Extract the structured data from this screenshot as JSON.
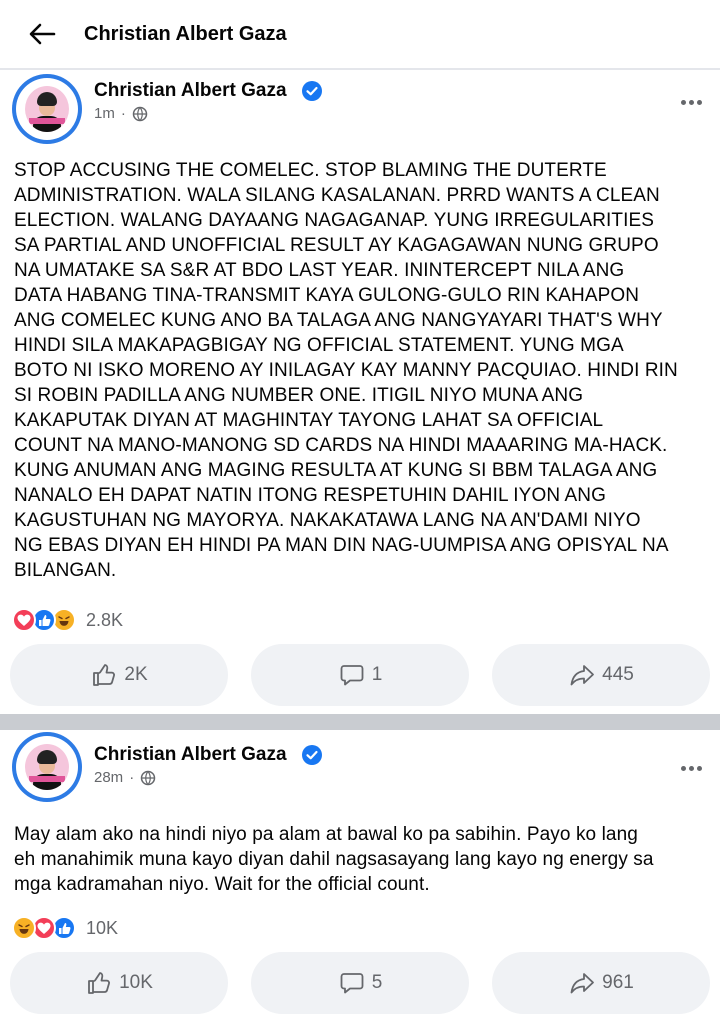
{
  "header": {
    "title": "Christian Albert Gaza",
    "back_icon": "arrow-left-icon"
  },
  "colors": {
    "verified": "#1877f2",
    "love": "#f33e58",
    "like": "#1877f2",
    "haha": "#f7b125",
    "muted_text": "#65676b",
    "button_bg": "#f0f2f5",
    "divider": "#c9ccd1"
  },
  "posts": [
    {
      "author": "Christian Albert Gaza",
      "time": "1m",
      "separator": "·",
      "audience_icon": "globe-icon",
      "verified_icon": "verified-badge-icon",
      "lines": [
        "STOP ACCUSING THE COMELEC. STOP BLAMING THE DUTERTE",
        "ADMINISTRATION. WALA SILANG KASALANAN. PRRD WANTS A CLEAN",
        "ELECTION. WALANG DAYAANG NAGAGANAP. YUNG IRREGULARITIES",
        "SA PARTIAL AND UNOFFICIAL RESULT AY KAGAGAWAN NUNG GRUPO",
        "NA UMATAKE SA S&R AT BDO LAST YEAR. ININTERCEPT NILA ANG",
        "DATA HABANG TINA-TRANSMIT KAYA GULONG-GULO RIN KAHAPON",
        "ANG COMELEC KUNG ANO BA TALAGA ANG NANGYAYARI THAT'S WHY",
        "HINDI SILA MAKAPAGBIGAY NG OFFICIAL STATEMENT. YUNG MGA",
        "BOTO NI ISKO MORENO AY INILAGAY KAY MANNY PACQUIAO. HINDI RIN",
        "SI ROBIN PADILLA ANG NUMBER ONE. ITIGIL NIYO MUNA ANG",
        "KAKAPUTAK DIYAN AT MAGHINTAY TAYONG LAHAT SA OFFICIAL",
        "COUNT NA MANO-MANONG SD CARDS NA HINDI MAAARING MA-HACK.",
        "KUNG ANUMAN ANG MAGING RESULTA AT KUNG SI BBM TALAGA ANG",
        "NANALO EH DAPAT NATIN ITONG RESPETUHIN DAHIL IYON ANG",
        "KAGUSTUHAN NG MAYORYA. NAKAKATAWA LANG NA AN'DAMI NIYO",
        "NG EBAS DIYAN EH HINDI PA MAN DIN NAG-UUMPISA ANG OPISYAL NA",
        "BILANGAN."
      ],
      "reactions": [
        "love",
        "like",
        "haha"
      ],
      "reaction_count": "2.8K",
      "like_count": "2K",
      "comment_count": "1",
      "share_count": "445"
    },
    {
      "author": "Christian Albert Gaza",
      "time": "28m",
      "separator": "·",
      "audience_icon": "globe-icon",
      "verified_icon": "verified-badge-icon",
      "lines": [
        "May alam ako na hindi niyo pa alam at bawal ko pa sabihin. Payo ko lang",
        "eh manahimik muna kayo diyan dahil nagsasayang lang kayo ng energy sa",
        "mga kadramahan niyo. Wait for the official count."
      ],
      "reactions": [
        "haha",
        "love",
        "like"
      ],
      "reaction_count": "10K",
      "like_count": "10K",
      "comment_count": "5",
      "share_count": "961"
    }
  ]
}
